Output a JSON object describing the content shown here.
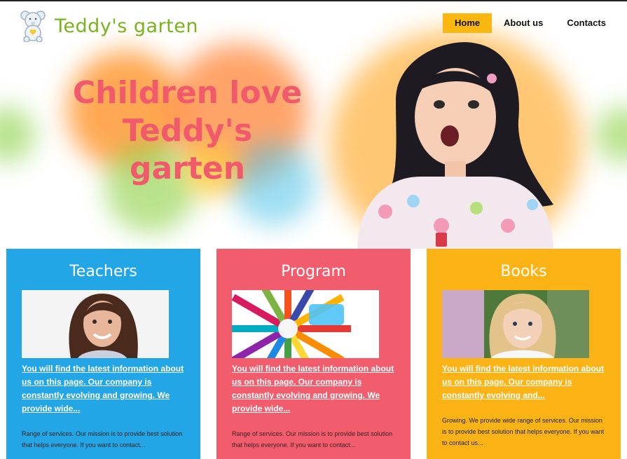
{
  "site": {
    "logo_text": "Teddy's garten"
  },
  "nav": [
    {
      "label": "Home"
    },
    {
      "label": "About us"
    },
    {
      "label": "Contacts"
    }
  ],
  "hero": {
    "headline": "Children love Teddy's garten"
  },
  "cards": [
    {
      "title": "Teachers",
      "link": "You will find the latest information about us on this page. Our company is constantly evolving and growing. We provide wide...",
      "text": "Range of services. Our mission is to provide best solution that helps everyone. If you want to contact..."
    },
    {
      "title": "Program",
      "link": "You will find the latest information about us on this page. Our company is constantly evolving and growing. We provide wide...",
      "text": "Range of services. Our mission is to provide best solution that helps everyone. If you want to contact..."
    },
    {
      "title": "Books",
      "link": "You will find the latest information about us on this page. Our company is constantly evolving and...",
      "text": "Growing. We provide wide range of services. Our mission is to provide best solution that helps everyone. If you want to contact us..."
    }
  ],
  "colors": {
    "teachers": "#23a6e6",
    "program": "#f25d6d",
    "books": "#fbb315",
    "accent": "#f9b70f",
    "logo": "#7ab31f"
  }
}
